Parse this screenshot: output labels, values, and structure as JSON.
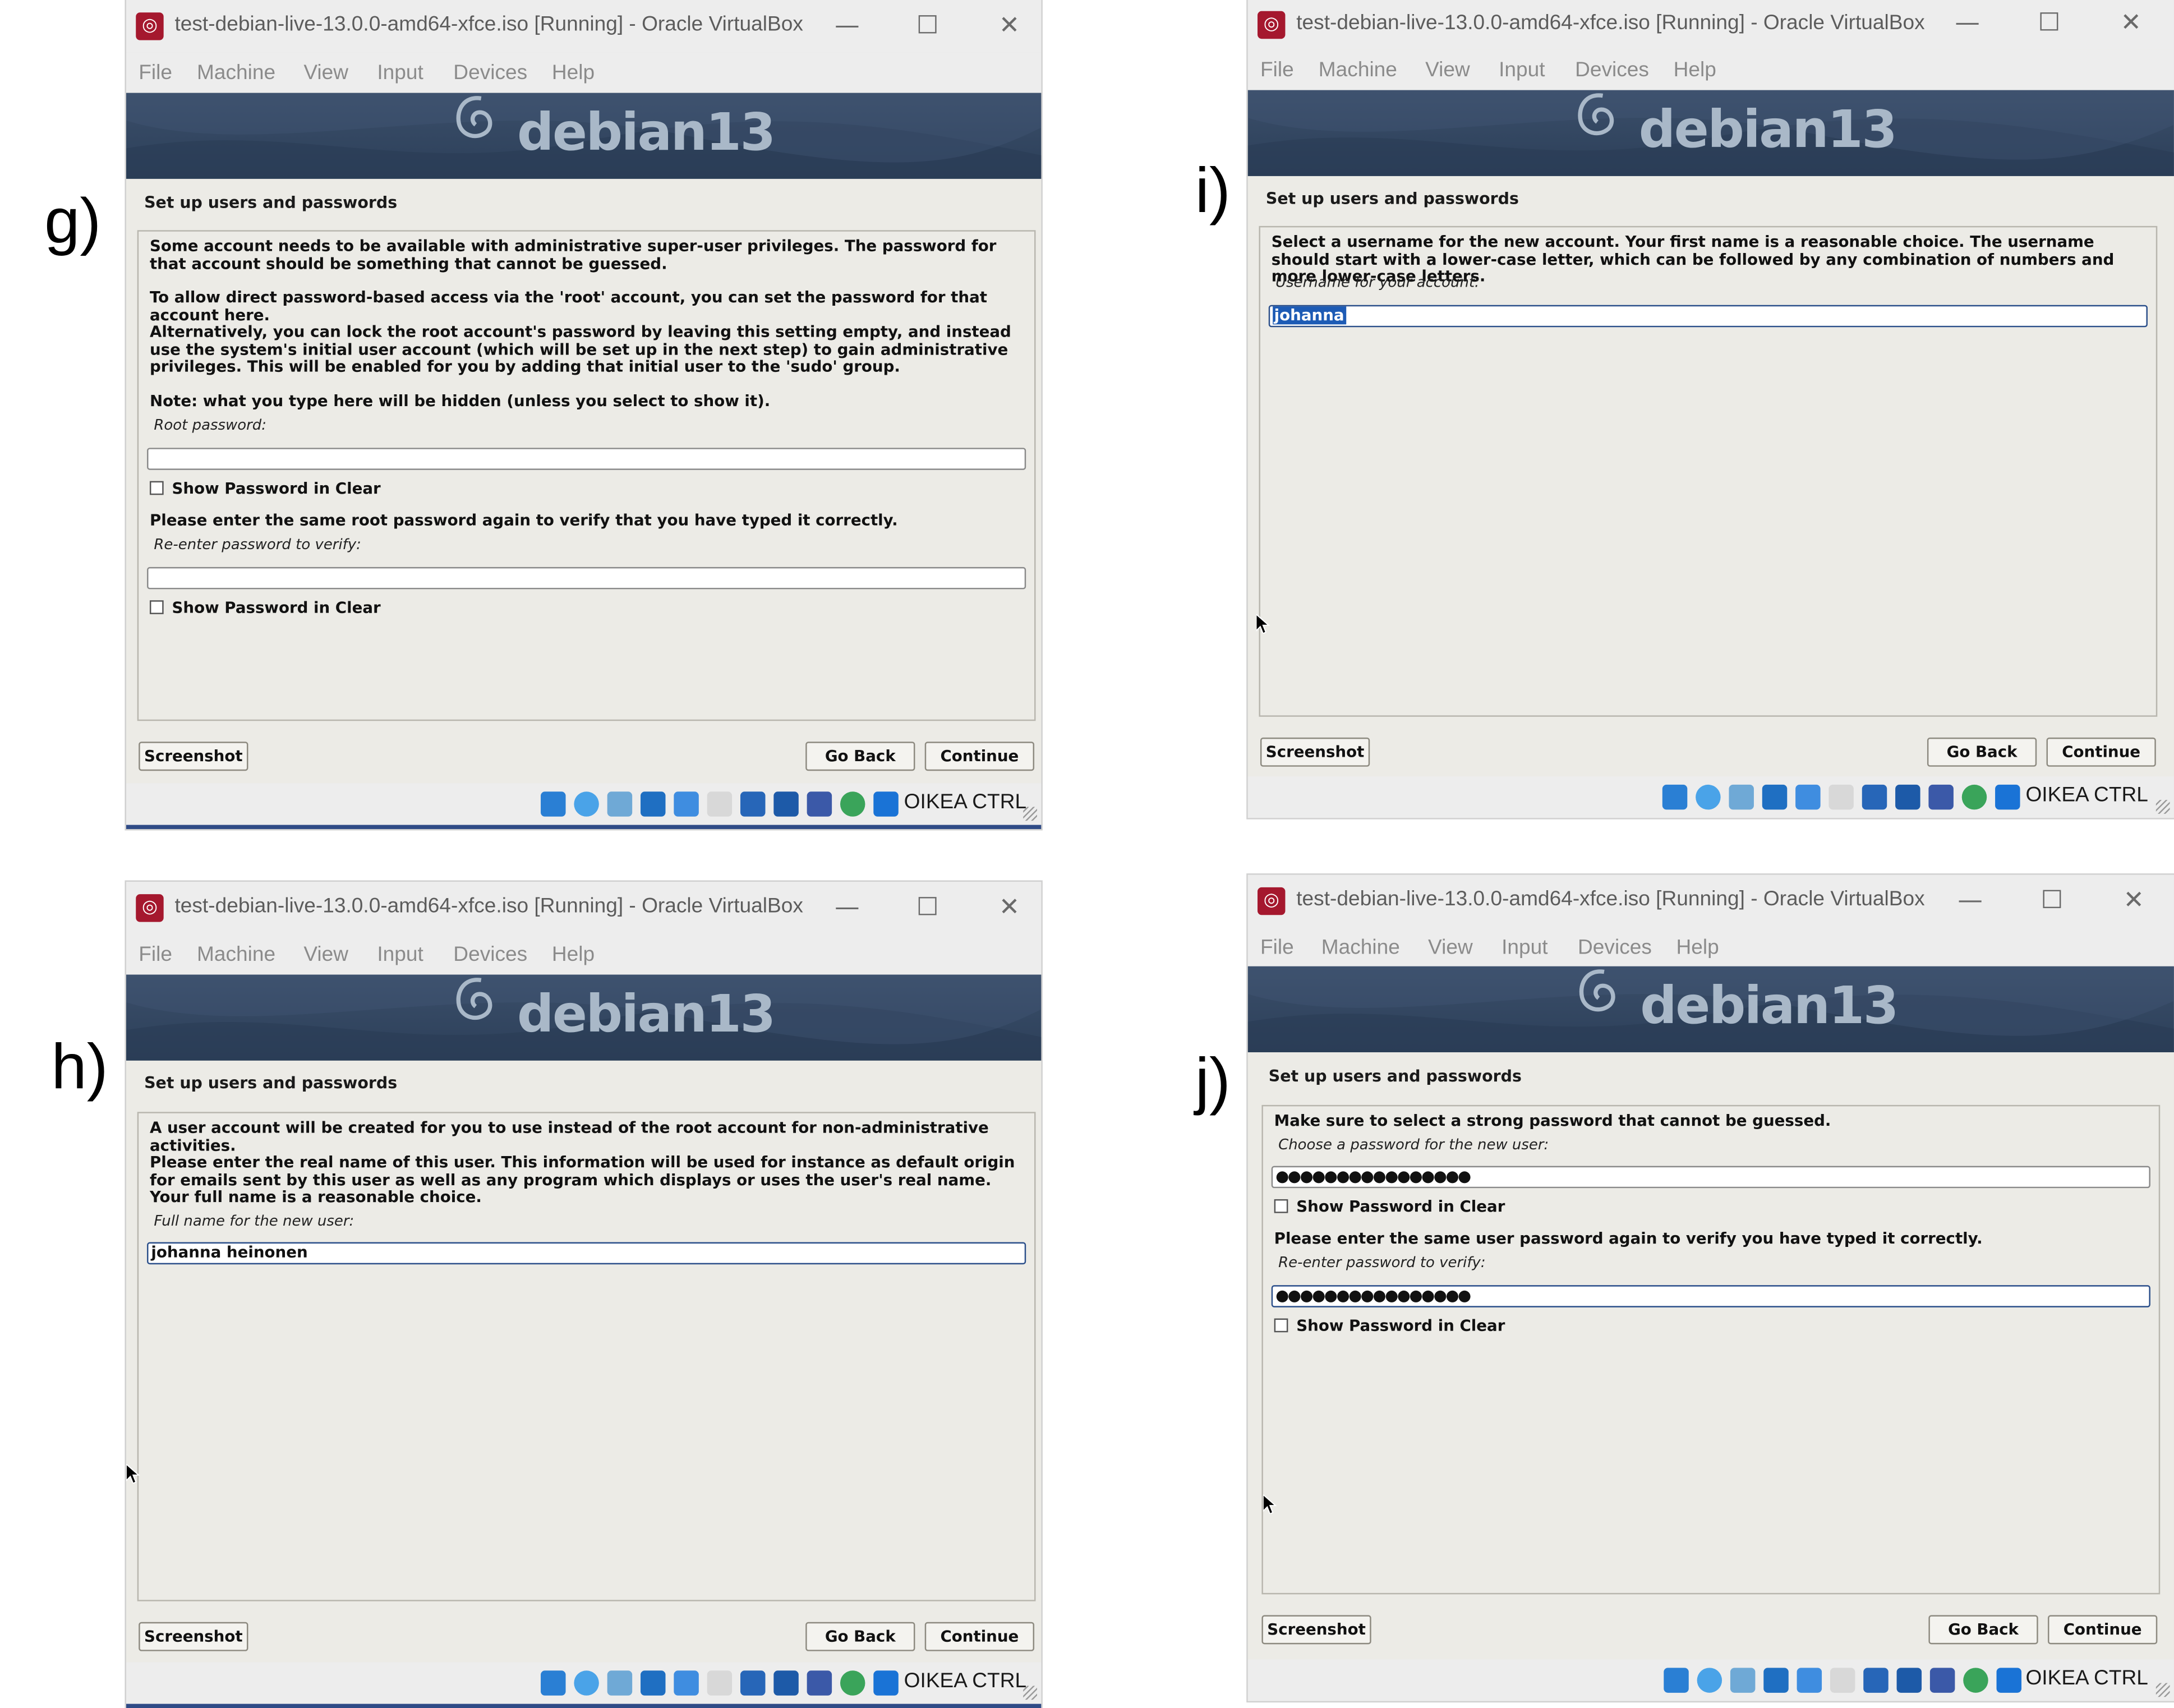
{
  "app": {
    "window_title": "test-debian-live-13.0.0-amd64-xfce.iso [Running] - Oracle VirtualBox",
    "menu": [
      "File",
      "Machine",
      "View",
      "Input",
      "Devices",
      "Help"
    ],
    "banner_text": "debian13",
    "host_key": "OIKEA CTRL",
    "icon_names": [
      "harddisk-icon",
      "optical-disc-icon",
      "audio-icon",
      "network-icon",
      "usb-icon",
      "shared-folder-icon",
      "display-icon",
      "recording-icon",
      "vbox-icon",
      "mouse-integration-icon",
      "keyboard-capture-icon"
    ]
  },
  "panels": {
    "g": {
      "label": "g)",
      "page_title": "Set up users and passwords",
      "paragraphs": [
        "Some account needs to be available with administrative super-user privileges. The password for that account should be something that cannot be guessed.",
        "To allow direct password-based access via the 'root' account, you can set the password for that account here.",
        "Alternatively, you can lock the root account's password by leaving this setting empty, and instead use the system's initial user account (which will be set up in the next step) to gain administrative privileges. This will be enabled for you by adding that initial user to the 'sudo' group.",
        "Note: what you type here will be hidden (unless you select to show it)."
      ],
      "field1_label": "Root password:",
      "field1_value": "",
      "show_clear_1": "Show Password in Clear",
      "verify_text": "Please enter the same root password again to verify that you have typed it correctly.",
      "field2_label": "Re-enter password to verify:",
      "field2_value": "",
      "show_clear_2": "Show Password in Clear",
      "buttons": {
        "screenshot": "Screenshot",
        "go_back": "Go Back",
        "continue": "Continue"
      }
    },
    "h": {
      "label": "h)",
      "page_title": "Set up users and passwords",
      "paragraphs": [
        "A user account will be created for you to use instead of the root account for non-administrative activities.",
        "Please enter the real name of this user. This information will be used for instance as default origin for emails sent by this user as well as any program which displays or uses the user's real name. Your full name is a reasonable choice."
      ],
      "field1_label": "Full name for the new user:",
      "field1_value": "johanna heinonen",
      "buttons": {
        "screenshot": "Screenshot",
        "go_back": "Go Back",
        "continue": "Continue"
      }
    },
    "i": {
      "label": "i)",
      "page_title": "Set up users and passwords",
      "paragraphs": [
        "Select a username for the new account. Your first name is a reasonable choice. The username should start with a lower-case letter, which can be followed by any combination of numbers and more lower-case letters."
      ],
      "field1_label": "Username for your account:",
      "field1_value": "johanna",
      "buttons": {
        "screenshot": "Screenshot",
        "go_back": "Go Back",
        "continue": "Continue"
      }
    },
    "j": {
      "label": "j)",
      "page_title": "Set up users and passwords",
      "paragraphs": [
        "Make sure to select a strong password that cannot be guessed."
      ],
      "field1_label": "Choose a password for the new user:",
      "field1_value": "●●●●●●●●●●●●●●●●",
      "show_clear_1": "Show Password in Clear",
      "verify_text": "Please enter the same user password again to verify you have typed it correctly.",
      "field2_label": "Re-enter password to verify:",
      "field2_value": "●●●●●●●●●●●●●●●●",
      "show_clear_2": "Show Password in Clear",
      "buttons": {
        "screenshot": "Screenshot",
        "go_back": "Go Back",
        "continue": "Continue"
      }
    }
  }
}
